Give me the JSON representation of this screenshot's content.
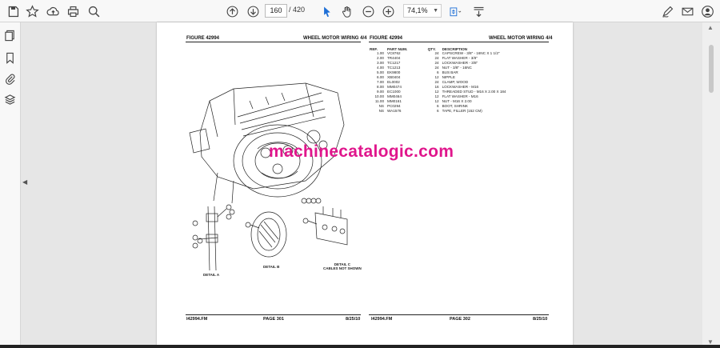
{
  "toolbar": {
    "page_current": "160",
    "page_total": "/ 420",
    "zoom": "74,1%"
  },
  "doc": {
    "left_page": {
      "figure": "FIGURE 42994",
      "title": "WHEEL MOTOR WIRING  4/4",
      "footer_file": "I42994.FM",
      "footer_page": "PAGE 301",
      "footer_date": "8/25/10",
      "detail_a": "DETAIL A",
      "detail_b": "DETAIL B",
      "detail_c_line1": "DETAIL C",
      "detail_c_line2": "CABLES NOT SHOWN"
    },
    "right_page": {
      "figure": "FIGURE 42994",
      "title": "WHEEL MOTOR WIRING  4/4",
      "footer_file": "I42994.FM",
      "footer_page": "PAGE 302",
      "footer_date": "8/25/10"
    },
    "parts_headers": [
      "REF.",
      "PART NUM.",
      "QTY.",
      "DESCRIPTION"
    ],
    "parts": [
      {
        "ref": "1.00",
        "part": "VC8762",
        "qty": "24",
        "desc": "CAPSCREW - 3/8\" - 16NC X 1 1/2\""
      },
      {
        "ref": "2.00",
        "part": "TR4404",
        "qty": "24",
        "desc": "FLAT WASHER - 3/8\""
      },
      {
        "ref": "3.00",
        "part": "TC1217",
        "qty": "24",
        "desc": "LOCKWASHER - 3/8\""
      },
      {
        "ref": "4.00",
        "part": "TC1213",
        "qty": "24",
        "desc": "NUT - 3/8\" - 16NC"
      },
      {
        "ref": "5.00",
        "part": "EK9800",
        "qty": "6",
        "desc": "BUS BAR"
      },
      {
        "ref": "6.00",
        "part": "XB0404",
        "qty": "12",
        "desc": "NIPPLE"
      },
      {
        "ref": "7.00",
        "part": "EL0002",
        "qty": "24",
        "desc": "CLAMP, WOOD"
      },
      {
        "ref": "8.00",
        "part": "MM0474",
        "qty": "16",
        "desc": "LOCKWASHER - M16"
      },
      {
        "ref": "9.00",
        "part": "EC1000",
        "qty": "12",
        "desc": "THREADED STUD - M16 X 2.00 X 184"
      },
      {
        "ref": "10.00",
        "part": "MM0464",
        "qty": "12",
        "desc": "FLAT WASHER - M16"
      },
      {
        "ref": "11.00",
        "part": "MM0161",
        "qty": "12",
        "desc": "NUT - M16 X 2.00"
      },
      {
        "ref": "NS",
        "part": "PC0294",
        "qty": "6",
        "desc": "BOOT, SHRINK"
      },
      {
        "ref": "NS",
        "part": "WA1576",
        "qty": "6",
        "desc": "TAPE, FILLER (152 CM)"
      }
    ],
    "watermark": "machinecatalogic.com"
  }
}
